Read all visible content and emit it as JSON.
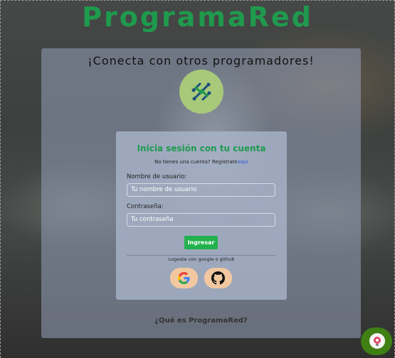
{
  "brand": {
    "name": "ProgramaRed",
    "color": "#1f9a4d"
  },
  "hero": {
    "tagline": "¡Conecta con otros programadores!",
    "logo_icon": "code-network-icon"
  },
  "login": {
    "title": "Inicia sesión con tu cuenta",
    "signup_prompt": "No tienes una cuenta? Registrate",
    "signup_link": "aqui",
    "username_label": "Nombre de usuario:",
    "username_placeholder": "Tu nombre de usuario",
    "password_label": "Contraseña:",
    "password_placeholder": "Tu contraseña",
    "submit_label": "Ingresar",
    "social_note": "Logeate con google o github",
    "social": [
      {
        "name": "google",
        "icon": "google-icon"
      },
      {
        "name": "github",
        "icon": "github-icon"
      }
    ]
  },
  "footer": {
    "about_link": "¿Qué es ProgramaRed?"
  },
  "colors": {
    "accent_green": "#22b14c",
    "link_blue": "#2d57d6",
    "chat_widget": "#3f7f14"
  }
}
